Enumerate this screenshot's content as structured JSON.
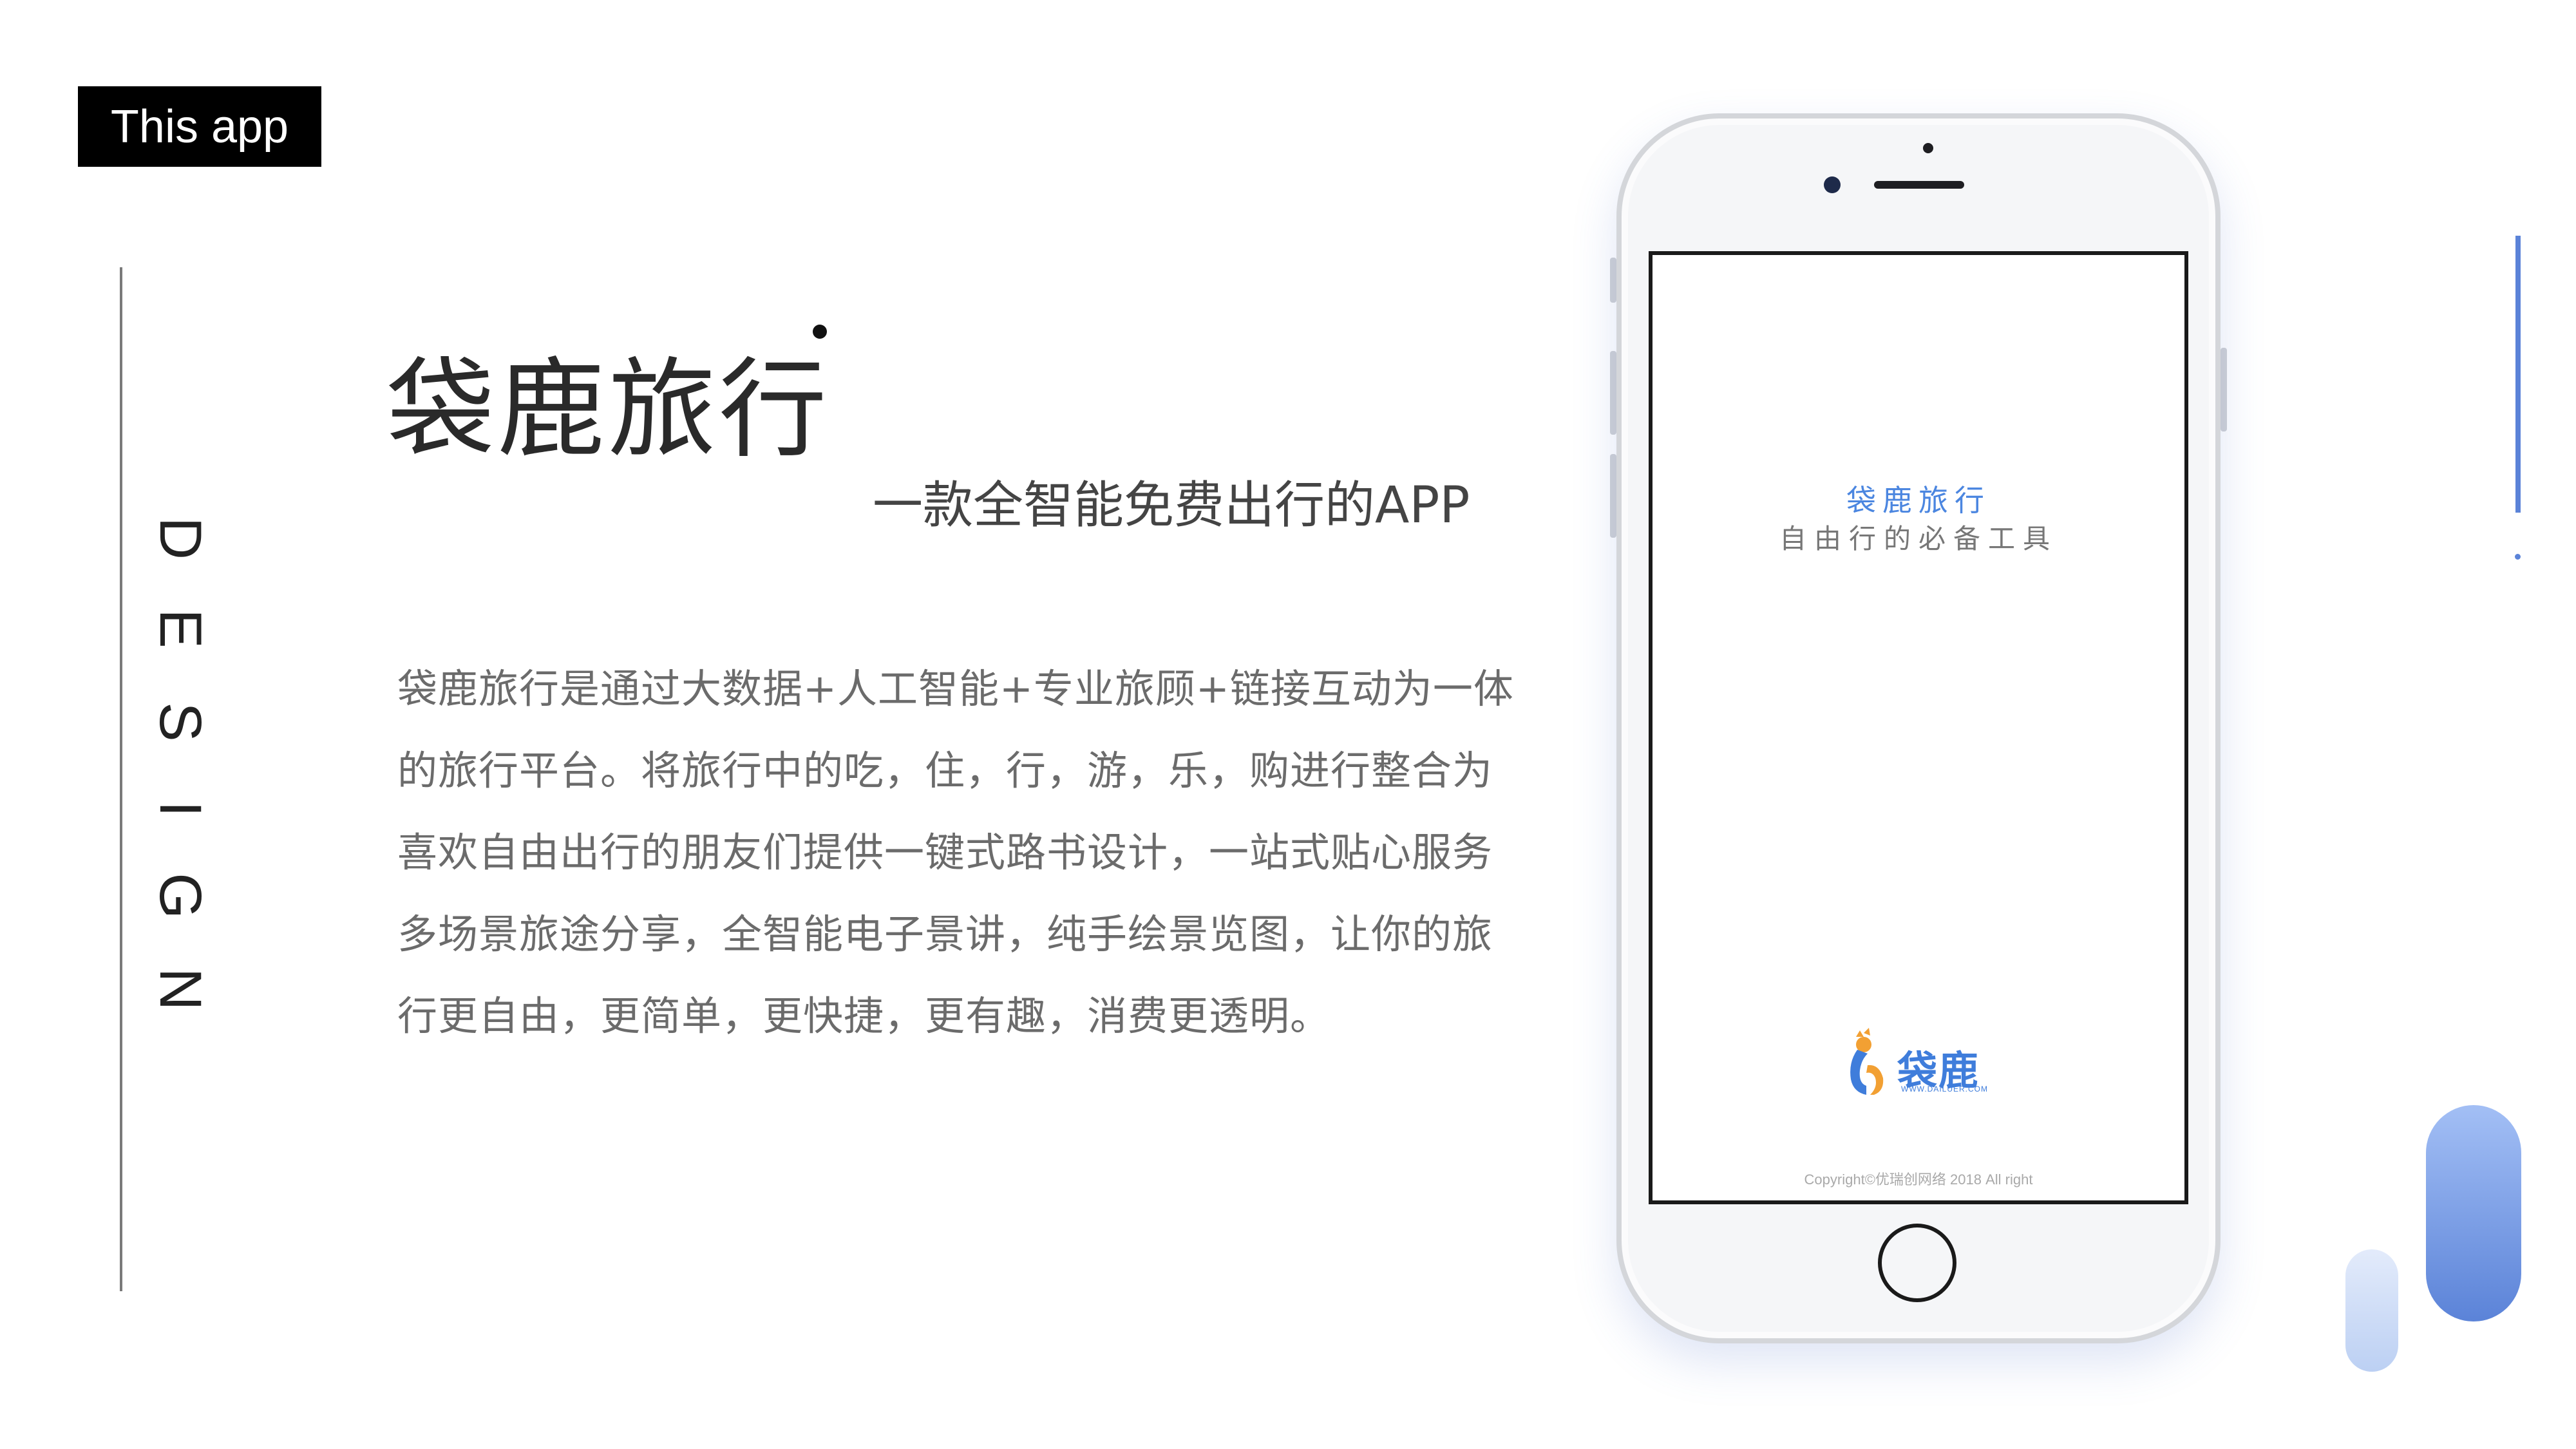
{
  "badge": {
    "label": "This app"
  },
  "side_label": {
    "letters": [
      "D",
      "E",
      "S",
      "I",
      "G",
      "N"
    ]
  },
  "hero": {
    "title": "袋鹿旅行",
    "subtitle": "一款全智能免费出行的APP"
  },
  "description": {
    "lines": [
      "袋鹿旅行是通过大数据+人工智能+专业旅顾+链接互动为一体",
      "的旅行平台。将旅行中的吃，住，行，游，乐，购进行整合为",
      "喜欢自由出行的朋友们提供一键式路书设计，一站式贴心服务",
      "多场景旅途分享，全智能电子景讲，纯手绘景览图，让你的旅",
      "行更自由，更简单，更快捷，更有趣，消费更透明。"
    ]
  },
  "phone_screen": {
    "title": "袋鹿旅行",
    "subtitle": "自由行的必备工具",
    "logo_text": "袋鹿",
    "logo_url": "WWW.DAILUER.COM",
    "copyright": "Copyright©优瑞创网络 2018 All right"
  },
  "colors": {
    "accent": "#5b83d8",
    "accent_light": "#a3bff5",
    "badge_bg": "#000000",
    "logo_orange": "#f2a033"
  }
}
